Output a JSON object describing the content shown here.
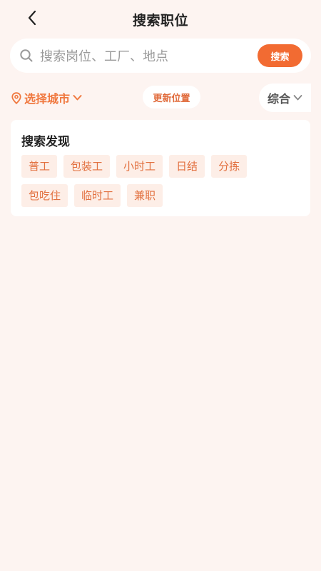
{
  "header": {
    "title": "搜索职位",
    "back_icon": "chevron-left-icon"
  },
  "search": {
    "placeholder": "搜索岗位、工厂、地点",
    "value": "",
    "button_label": "搜索",
    "icon": "search-icon"
  },
  "filters": {
    "city_label": "选择城市",
    "city_icon": "location-pin-icon",
    "update_location_label": "更新位置",
    "sort_label": "综合"
  },
  "discover": {
    "title": "搜索发现",
    "tags_row1": [
      "普工",
      "包装工",
      "小时工",
      "日结",
      "分拣"
    ],
    "tags_row2": [
      "包吃住",
      "临时工",
      "兼职"
    ]
  },
  "colors": {
    "background": "#fdf4f1",
    "accent": "#f26b32",
    "tag_bg": "#fdeee7",
    "tag_text": "#e2703f"
  }
}
